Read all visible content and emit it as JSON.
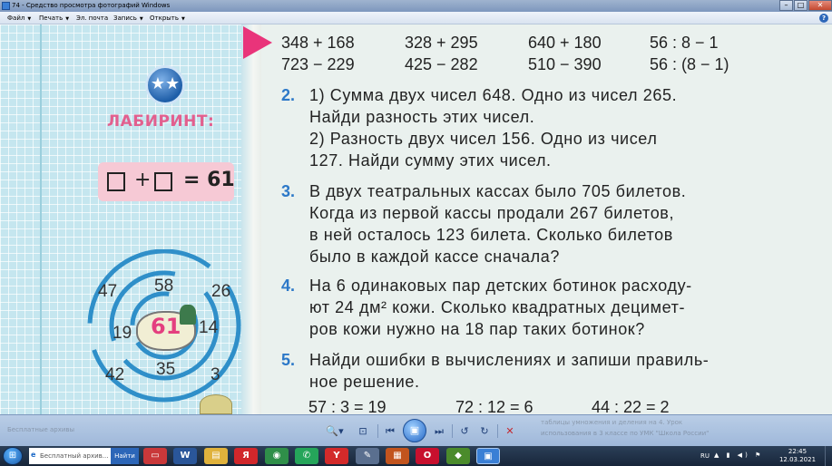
{
  "window": {
    "title": "74 - Средство просмотра фотографий Windows",
    "controls": {
      "minimize": "–",
      "maximize": "□",
      "close": "✕"
    }
  },
  "menu": {
    "items": [
      {
        "label": "Файл",
        "has_arrow": true
      },
      {
        "label": "Печать",
        "has_arrow": true
      },
      {
        "label": "Эл. почта",
        "has_arrow": false
      },
      {
        "label": "Запись",
        "has_arrow": true
      },
      {
        "label": "Открыть",
        "has_arrow": true
      }
    ],
    "help_icon": "?"
  },
  "photo": {
    "sidebar": {
      "badge_icon": "★★",
      "title": "ЛАБИРИНТ:",
      "equation": {
        "plus": "+",
        "result": "= 61"
      },
      "maze_numbers": [
        "58",
        "47",
        "26",
        "19",
        "14",
        "42",
        "35",
        "3"
      ],
      "maze_center": "61"
    },
    "exercises": {
      "row1": [
        "348 + 168",
        "328 + 295",
        "640 + 180",
        "56 : 8 − 1"
      ],
      "row2": [
        "723 − 229",
        "425 − 282",
        "510 − 390",
        "56 : (8 − 1)"
      ]
    },
    "tasks": [
      {
        "number": "2.",
        "lines": [
          "1) Сумма двух чисел 648. Одно из чисел 265.",
          "Найди разность этих чисел.",
          "2) Разность двух чисел 156. Одно из чисел",
          "127. Найди сумму этих чисел."
        ]
      },
      {
        "number": "3.",
        "lines": [
          "В двух театральных кассах было 705 билетов.",
          "Когда из первой кассы продали 267 билетов,",
          "в ней осталось 123 билета. Сколько билетов",
          "было в каждой кассе сначала?"
        ]
      },
      {
        "number": "4.",
        "lines": [
          "На 6 одинаковых пар детских ботинок расходу-",
          "ют 24 дм² кожи. Сколько квадратных децимет-",
          "ров кожи нужно на 18 пар таких ботинок?"
        ]
      },
      {
        "number": "5.",
        "lines": [
          "Найди ошибки в вычислениях и запиши правиль-",
          "ное решение."
        ]
      }
    ],
    "bottom_row": [
      "57 : 3 = 19",
      "72 : 12 = 6",
      "44 : 22 = 2"
    ]
  },
  "viewer_controls": {
    "zoom": "🔍▾",
    "fit": "⊡",
    "prev": "⏮",
    "play": "▣",
    "next": "⏭",
    "rotate_ccw": "↺",
    "rotate_cw": "↻",
    "delete": "✕",
    "underlay_texts": [
      "Бесплатные архивы",
      "таблицы умножения и деления на 4. Урок",
      "использования в 3 классе по УМК \"Школа России\""
    ]
  },
  "taskbar": {
    "start_icon": "⊞",
    "search_text": "Бесплатный архив...",
    "search_button": "Найти",
    "apps": [
      "▭",
      "W",
      "▤",
      "Я",
      "◉",
      "✆",
      "Y",
      "✎",
      "▦",
      "O",
      "◆",
      "▣"
    ],
    "tray": {
      "language": "RU",
      "icons": "▲ ▮ ◀) ⚑",
      "time": "22:45",
      "date": "12.03.2021"
    }
  },
  "colors": {
    "task_number_blue": "#2c78c8",
    "maze_pink": "#e43f7f",
    "arrow_pink": "#e9347a",
    "sidebar_blue": "#c5e6ef"
  }
}
